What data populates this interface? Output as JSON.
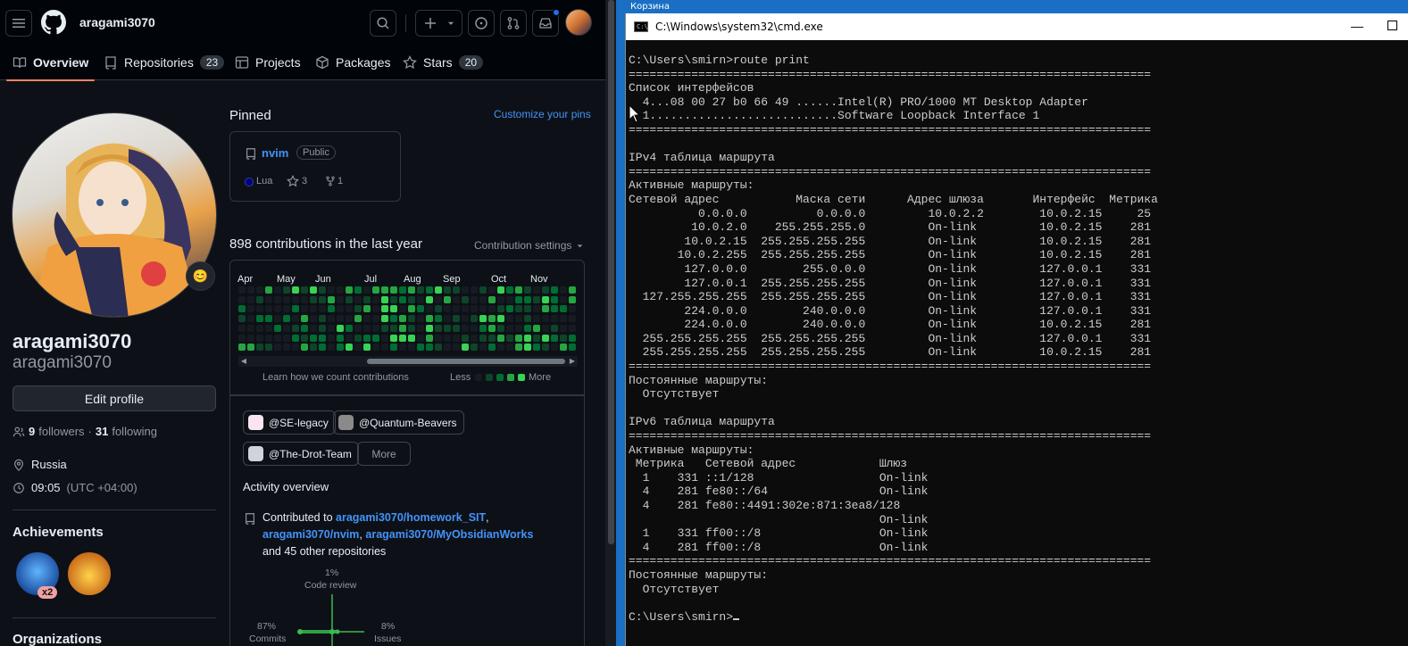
{
  "github": {
    "username": "aragami3070",
    "tabs": [
      {
        "label": "Overview",
        "count": ""
      },
      {
        "label": "Repositories",
        "count": "23"
      },
      {
        "label": "Projects",
        "count": ""
      },
      {
        "label": "Packages",
        "count": ""
      },
      {
        "label": "Stars",
        "count": "20"
      }
    ],
    "profile": {
      "display_name": "aragami3070",
      "login": "aragami3070",
      "edit_button": "Edit profile",
      "followers_count": "9",
      "followers_label": "followers",
      "following_count": "31",
      "following_label": "following",
      "location": "Russia",
      "local_time": "09:05",
      "timezone": "(UTC +04:00)",
      "achievements_title": "Achievements",
      "achievement_multiplier": "x2",
      "organizations_title": "Organizations"
    },
    "pinned": {
      "title": "Pinned",
      "customize": "Customize your pins",
      "repo_name": "nvim",
      "visibility": "Public",
      "language": "Lua",
      "language_color": "#000080",
      "stars": "3",
      "forks": "1"
    },
    "contributions": {
      "heading": "898 contributions in the last year",
      "settings": "Contribution settings",
      "months": [
        "Apr",
        "May",
        "Jun",
        "Jul",
        "Aug",
        "Sep",
        "Oct",
        "Nov"
      ],
      "learn": "Learn how we count contributions",
      "less": "Less",
      "more": "More"
    },
    "orgs": [
      "@SE-legacy",
      "@Quantum-Beavers",
      "@The-Drot-Team"
    ],
    "orgs_more": "More",
    "activity": {
      "title": "Activity overview",
      "contributed_to": "Contributed to",
      "repo1": "aragami3070/homework_SIT",
      "repo2": "aragami3070/nvim",
      "repo3": "aragami3070/MyObsidianWorks",
      "and_other": "and 45 other repositories",
      "code_review_pct": "1%",
      "code_review_label": "Code review",
      "commits_pct": "87%",
      "commits_label": "Commits",
      "issues_pct": "8%",
      "issues_label": "Issues"
    }
  },
  "desktop": {
    "recycle_bin_label": "Корзина"
  },
  "cmd": {
    "title": "C:\\Windows\\system32\\cmd.exe",
    "lines": [
      "C:\\Users\\smirn>route print",
      "===========================================================================",
      "Список интерфейсов",
      "  4...08 00 27 b0 66 49 ......Intel(R) PRO/1000 MT Desktop Adapter",
      "  1...........................Software Loopback Interface 1",
      "===========================================================================",
      "",
      "IPv4 таблица маршрута",
      "===========================================================================",
      "Активные маршруты:",
      "Сетевой адрес           Маска сети      Адрес шлюза       Интерфейс  Метрика",
      "          0.0.0.0          0.0.0.0         10.0.2.2        10.0.2.15     25",
      "         10.0.2.0    255.255.255.0         On-link         10.0.2.15    281",
      "        10.0.2.15  255.255.255.255         On-link         10.0.2.15    281",
      "       10.0.2.255  255.255.255.255         On-link         10.0.2.15    281",
      "        127.0.0.0        255.0.0.0         On-link         127.0.0.1    331",
      "        127.0.0.1  255.255.255.255         On-link         127.0.0.1    331",
      "  127.255.255.255  255.255.255.255         On-link         127.0.0.1    331",
      "        224.0.0.0        240.0.0.0         On-link         127.0.0.1    331",
      "        224.0.0.0        240.0.0.0         On-link         10.0.2.15    281",
      "  255.255.255.255  255.255.255.255         On-link         127.0.0.1    331",
      "  255.255.255.255  255.255.255.255         On-link         10.0.2.15    281",
      "===========================================================================",
      "Постоянные маршруты:",
      "  Отсутствует",
      "",
      "IPv6 таблица маршрута",
      "===========================================================================",
      "Активные маршруты:",
      " Метрика   Сетевой адрес            Шлюз",
      "  1    331 ::1/128                  On-link",
      "  4    281 fe80::/64                On-link",
      "  4    281 fe80::4491:302e:871:3ea8/128",
      "                                    On-link",
      "  1    331 ff00::/8                 On-link",
      "  4    281 ff00::/8                 On-link",
      "===========================================================================",
      "Постоянные маршруты:",
      "  Отсутствует",
      "",
      "C:\\Users\\smirn>"
    ]
  },
  "colors": {
    "gh_bg": "#0d1117",
    "gh_link": "#4493f8",
    "tab_underline": "#f78166",
    "cal_levels": [
      "#161b22",
      "#0e4429",
      "#006d32",
      "#26a641",
      "#39d353"
    ],
    "cmd_bg": "#0c0c0c",
    "cmd_fg": "#cccccc",
    "desktop_bg": "#1a6fc4"
  }
}
